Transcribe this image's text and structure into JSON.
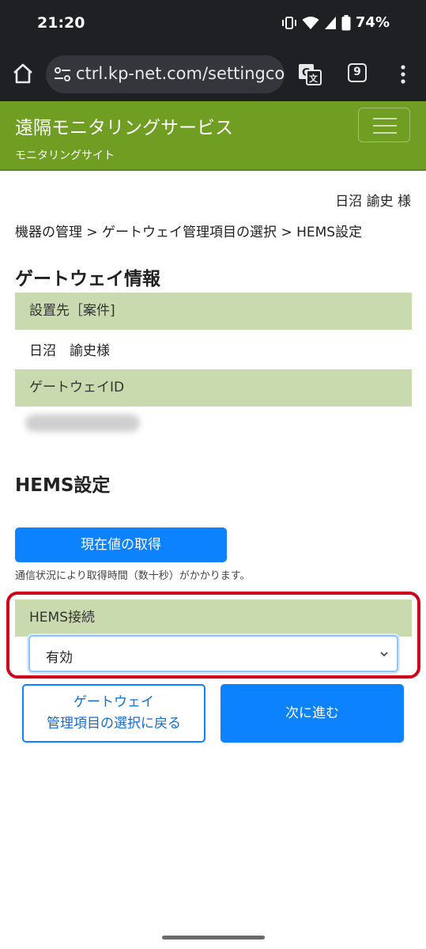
{
  "status_bar": {
    "time": "21:20",
    "battery": "74%",
    "icons": [
      "vibrate-icon",
      "wifi-icon",
      "signal-icon",
      "battery-icon"
    ]
  },
  "browser": {
    "url": "ctrl.kp-net.com/settingcor",
    "tab_count": "9",
    "icons": [
      "home-icon",
      "site-settings-icon",
      "translate-icon",
      "tabs-icon",
      "more-menu-icon"
    ]
  },
  "header": {
    "title": "遠隔モニタリングサービス",
    "subtitle": "モニタリングサイト",
    "bg_color": "#6f9e22"
  },
  "user": {
    "name": "日沼 諭史 様"
  },
  "breadcrumb": {
    "text": "機器の管理 > ゲートウェイ管理項目の選択 > HEMS設定"
  },
  "gateway_info": {
    "title": "ゲートウェイ情報",
    "location_label": "設置先［案件]",
    "location_value": "日沼　諭史様",
    "id_label": "ゲートウェイID"
  },
  "hems": {
    "title": "HEMS設定",
    "fetch_button": "現在値の取得",
    "note": "通信状況により取得時間（数十秒）がかかります。",
    "connection_label": "HEMS接続",
    "connection_value": "有効",
    "back_button_line1": "ゲートウェイ",
    "back_button_line2": "管理項目の選択に戻る",
    "next_button": "次に進む",
    "accent_color": "#0d82ff",
    "highlight_color": "#d0021b"
  }
}
